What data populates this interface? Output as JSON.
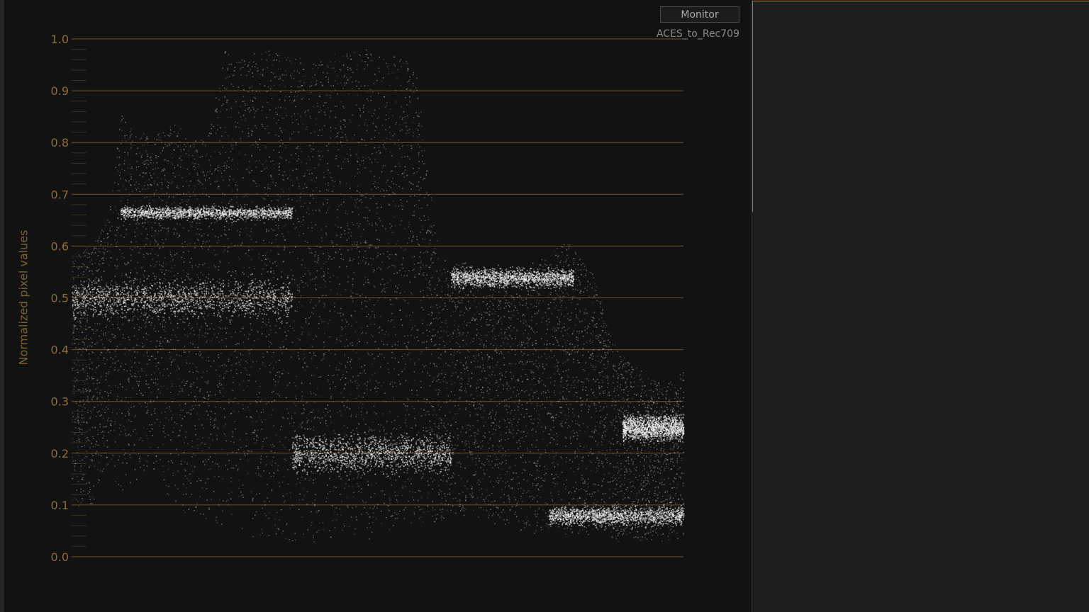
{
  "scope": {
    "monitor_button_label": "Monitor",
    "lut_label": "ACES_to_Rec709",
    "accent_color": "#b7782b",
    "icons": []
  },
  "chart_data": {
    "type": "scatter",
    "title": "",
    "xlabel": "",
    "ylabel": "Normalized pixel values",
    "ylim": [
      0.0,
      1.0
    ],
    "yticks": [
      "0.0",
      "0.1",
      "0.2",
      "0.3",
      "0.4",
      "0.5",
      "0.6",
      "0.7",
      "0.8",
      "0.9",
      "1.0"
    ],
    "grid": true,
    "description_type": "waveform",
    "columns": [
      {
        "x": 0.0,
        "lo": 0.1,
        "hi": 0.58
      },
      {
        "x": 0.03,
        "lo": 0.09,
        "hi": 0.6
      },
      {
        "x": 0.06,
        "lo": 0.18,
        "hi": 0.66
      },
      {
        "x": 0.08,
        "lo": 0.12,
        "hi": 0.86
      },
      {
        "x": 0.1,
        "lo": 0.14,
        "hi": 0.83
      },
      {
        "x": 0.13,
        "lo": 0.18,
        "hi": 0.81
      },
      {
        "x": 0.16,
        "lo": 0.1,
        "hi": 0.84
      },
      {
        "x": 0.19,
        "lo": 0.08,
        "hi": 0.82
      },
      {
        "x": 0.22,
        "lo": 0.06,
        "hi": 0.8
      },
      {
        "x": 0.25,
        "lo": 0.06,
        "hi": 0.98
      },
      {
        "x": 0.29,
        "lo": 0.04,
        "hi": 0.97
      },
      {
        "x": 0.33,
        "lo": 0.04,
        "hi": 0.98
      },
      {
        "x": 0.36,
        "lo": 0.03,
        "hi": 0.97
      },
      {
        "x": 0.4,
        "lo": 0.02,
        "hi": 0.96
      },
      {
        "x": 0.44,
        "lo": 0.02,
        "hi": 0.98
      },
      {
        "x": 0.48,
        "lo": 0.03,
        "hi": 0.98
      },
      {
        "x": 0.52,
        "lo": 0.04,
        "hi": 0.97
      },
      {
        "x": 0.56,
        "lo": 0.05,
        "hi": 0.96
      },
      {
        "x": 0.6,
        "lo": 0.07,
        "hi": 0.58
      },
      {
        "x": 0.64,
        "lo": 0.08,
        "hi": 0.57
      },
      {
        "x": 0.68,
        "lo": 0.07,
        "hi": 0.56
      },
      {
        "x": 0.72,
        "lo": 0.05,
        "hi": 0.55
      },
      {
        "x": 0.81,
        "lo": 0.04,
        "hi": 0.61
      },
      {
        "x": 0.85,
        "lo": 0.04,
        "hi": 0.55
      },
      {
        "x": 0.89,
        "lo": 0.03,
        "hi": 0.4
      },
      {
        "x": 0.93,
        "lo": 0.03,
        "hi": 0.36
      },
      {
        "x": 0.97,
        "lo": 0.03,
        "hi": 0.33
      },
      {
        "x": 1.0,
        "lo": 0.03,
        "hi": 0.36
      }
    ],
    "bands": [
      {
        "x0": 0.08,
        "x1": 0.36,
        "y": 0.665,
        "spread": 0.02
      },
      {
        "x0": 0.0,
        "x1": 0.36,
        "y": 0.5,
        "spread": 0.06
      },
      {
        "x0": 0.36,
        "x1": 0.62,
        "y": 0.2,
        "spread": 0.06
      },
      {
        "x0": 0.62,
        "x1": 0.82,
        "y": 0.54,
        "spread": 0.03
      },
      {
        "x0": 0.78,
        "x1": 1.0,
        "y": 0.08,
        "spread": 0.03
      },
      {
        "x0": 0.9,
        "x1": 1.0,
        "y": 0.25,
        "spread": 0.04
      }
    ]
  }
}
